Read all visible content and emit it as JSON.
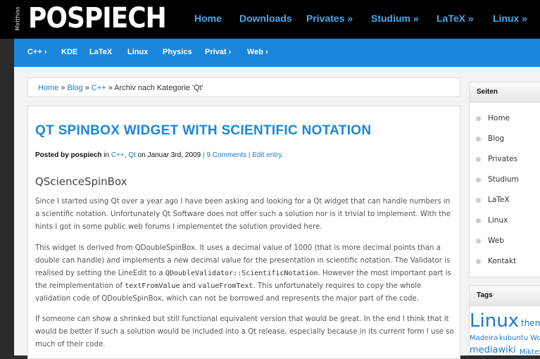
{
  "site": {
    "logo_small": "Matthias",
    "logo_big": "POSPIECH"
  },
  "topnav": [
    "Home",
    "Downloads",
    "Privates »",
    "Studium »",
    "LaTeX »",
    "Linux »"
  ],
  "bluenav": [
    "C++ ›",
    "KDE",
    "LaTeX",
    "Linux",
    "Physics",
    "Privat ›",
    "Web ›"
  ],
  "breadcrumb": {
    "home": "Home",
    "sep1": "»",
    "blog": "Blog",
    "sep2": "»",
    "cpp": "C++",
    "rest": "» Archiv nach Kategorie 'Qt'"
  },
  "post": {
    "title": "QT SPINBOX WIDGET WITH SCIENTIFIC NOTATION",
    "meta_posted": "Posted by",
    "meta_author": "pospiech",
    "meta_in": "in",
    "meta_cat1": "C++",
    "meta_comma": ",",
    "meta_cat2": "Qt",
    "meta_on": "on",
    "meta_date": "Januar 3rd, 2009",
    "meta_sep": "|",
    "meta_comments": "9 Comments",
    "meta_sep2": "|",
    "meta_edit": "Edit entry.",
    "subheading": "QScienceSpinBox",
    "para1": "Since I started using Qt over a year ago I have been asking and looking for a Qt widget that can handle numbers in a scientific notation. Unfortunately Qt Software does not offer such a solution nor is it trivial to implement. With the hints I got in some public web forums I implementet the solution provided here.",
    "para2_a": "This widget is derived from QDoubleSpinBox. It uses a decimal value of 1000 (that is more decimal points than a double can handle) and implements a new decimal value for the presentation in scientific notation. The Validator is realised by setting the LineEdit to a",
    "para2_code1": "QDoubleValidator::ScientificNotation",
    "para2_b": ". However the most important part is the reimplementation of",
    "para2_code2": "textFromValue",
    "para2_c": "and",
    "para2_code3": "valueFromText",
    "para2_d": ". This unfortunately requires to copy the whole validation code of QDoubleSpinBox, which can not be borrowed and represents the major part of the code.",
    "para3": "If someone can show a shrinked but still functional equivalent version that would be great. In the end I think that it would be better if such a solution would be included into a Qt release, especially because in its current form I use so much of their code."
  },
  "sidebar": {
    "pages_title": "Seiten",
    "pages": [
      "Home",
      "Blog",
      "Privates",
      "Studium",
      "LaTeX",
      "Linux",
      "Web",
      "Kontakt"
    ],
    "tags_title": "Tags",
    "tags": [
      "Linux",
      "them",
      "Madeira",
      "kubuntu",
      "Wo",
      "mediawiki",
      "Miktex"
    ]
  },
  "colors": {
    "accent": "#1b86d9",
    "link": "#1b79c9",
    "topnav_link": "#4aa8e8"
  }
}
